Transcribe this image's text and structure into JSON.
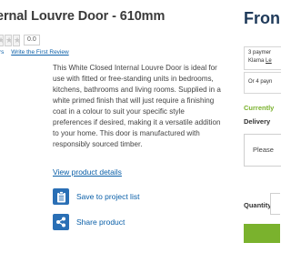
{
  "product": {
    "title": "ernal Louvre Door - 610mm",
    "rating": {
      "stars_filled": 0,
      "stars_total": 5,
      "score": "0.0"
    },
    "reviews_count_text": "rs",
    "write_review_link": "Write the First Review",
    "description": "This White Closed Internal Louvre Door is ideal for use with fitted or free-standing units in bedrooms, kitchens, bathrooms and living rooms. Supplied in a white primed finish that will just require a finishing coat in a colour to suit your specific style preferences if desired, making it a versatile addition to your home. This door is manufactured with responsibly sourced timber.",
    "view_details_link": "View product details",
    "actions": [
      {
        "label": "Save to project list",
        "icon": "clipboard-icon"
      },
      {
        "label": "Share product",
        "icon": "share-icon"
      }
    ]
  },
  "purchase_panel": {
    "from_label": "Fron",
    "klarna": {
      "line1": "3 paymer",
      "line2_prefix": "Klarna ",
      "line2_link": "Le"
    },
    "payments_text": "Or 4 payn",
    "availability": "Currently",
    "delivery_label": "Delivery",
    "delivery_select_value": "Please",
    "quantity_label": "Quantity:",
    "colors": {
      "accent_green": "#7ab22d",
      "link_blue": "#0a5fa8",
      "icon_blue": "#2a6fb5",
      "price_navy": "#1f3a5a"
    }
  }
}
